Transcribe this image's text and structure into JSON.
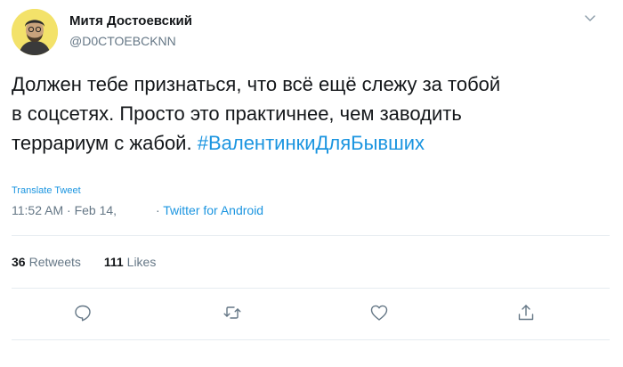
{
  "user": {
    "display_name": "Митя Достоевский",
    "handle": "@D0CTOEBCKNN"
  },
  "tweet": {
    "lines": [
      "Должен тебе признаться, что всё ещё слежу за тобой",
      "в соцсетях. Просто это практичнее, чем заводить",
      "террариум с жабой."
    ],
    "hashtag": "#ВалентинкиДляБывших"
  },
  "translate_label": "Translate Tweet",
  "meta": {
    "time": "11:52 AM",
    "separator": "·",
    "date": "Feb 14,",
    "via_separator": "·",
    "source": "Twitter for Android"
  },
  "stats": {
    "retweets_count": "36",
    "retweets_label": "Retweets",
    "likes_count": "111",
    "likes_label": "Likes"
  },
  "icons": {
    "avatar": "avatar",
    "caret": "chevron-down-icon",
    "reply": "reply-icon",
    "retweet": "retweet-icon",
    "like": "heart-icon",
    "share": "share-icon"
  },
  "colors": {
    "link": "#1b95e0",
    "muted": "#657786",
    "text": "#14171a",
    "divider": "#e6ecf0",
    "avatar_bg": "#f3e26a"
  }
}
